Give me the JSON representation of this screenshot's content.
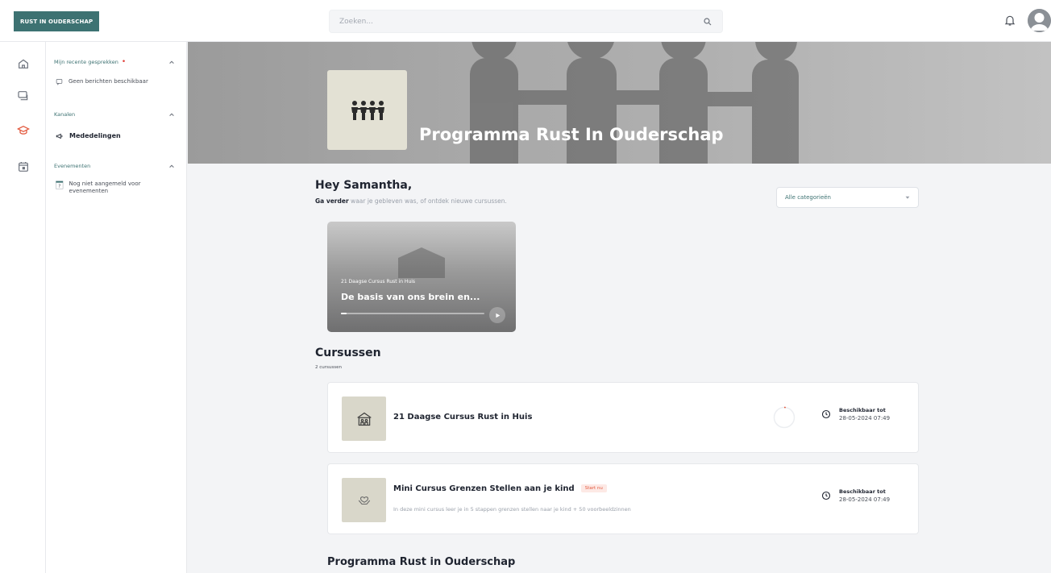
{
  "brand": {
    "label": "RUST IN OUDERSCHAP",
    "color": "#3d7272"
  },
  "search": {
    "placeholder": "Zoeken..."
  },
  "icons": {
    "search": "search-icon",
    "bell": "bell-icon",
    "avatar": "avatar",
    "rail": [
      "home-icon",
      "chat-icon",
      "graduation-cap-icon",
      "calendar-icon"
    ]
  },
  "sidebar": {
    "recent": {
      "title": "Mijn recente gesprekken",
      "empty": "Geen berichten beschikbaar"
    },
    "channels": {
      "title": "Kanalen",
      "item": "Mededelingen"
    },
    "events": {
      "title": "Evenementen",
      "empty": "Nog niet aangemeld voor evenementen"
    }
  },
  "hero": {
    "title": "Programma Rust In Ouderschap"
  },
  "greeting": {
    "title": "Hey Samantha,",
    "sub_strong": "Ga verder",
    "sub_rest": " waar je gebleven was, of ontdek nieuwe cursussen."
  },
  "category_filter": {
    "value": "Alle categorieën"
  },
  "resume_card": {
    "course": "21 Daagse Cursus Rust in Huis",
    "lesson": "De basis van ons brein en...",
    "progress": 0.04
  },
  "courses": {
    "title": "Cursussen",
    "count": "2 cursussen",
    "items": [
      {
        "title": "21 Daagse Cursus Rust in Huis",
        "badge": "",
        "description": "",
        "avail_label": "Beschikbaar tot",
        "avail_date": "28-05-2024 07:49"
      },
      {
        "title": "Mini Cursus Grenzen Stellen aan je kind",
        "badge": "Start nu",
        "description": "In deze mini cursus leer je in 5 stappen grenzen stellen naar je kind + 50 voorbeeldzinnen",
        "avail_label": "Beschikbaar tot",
        "avail_date": "28-05-2024 07:49"
      }
    ]
  },
  "program_section": {
    "title": "Programma Rust in Ouderschap"
  }
}
